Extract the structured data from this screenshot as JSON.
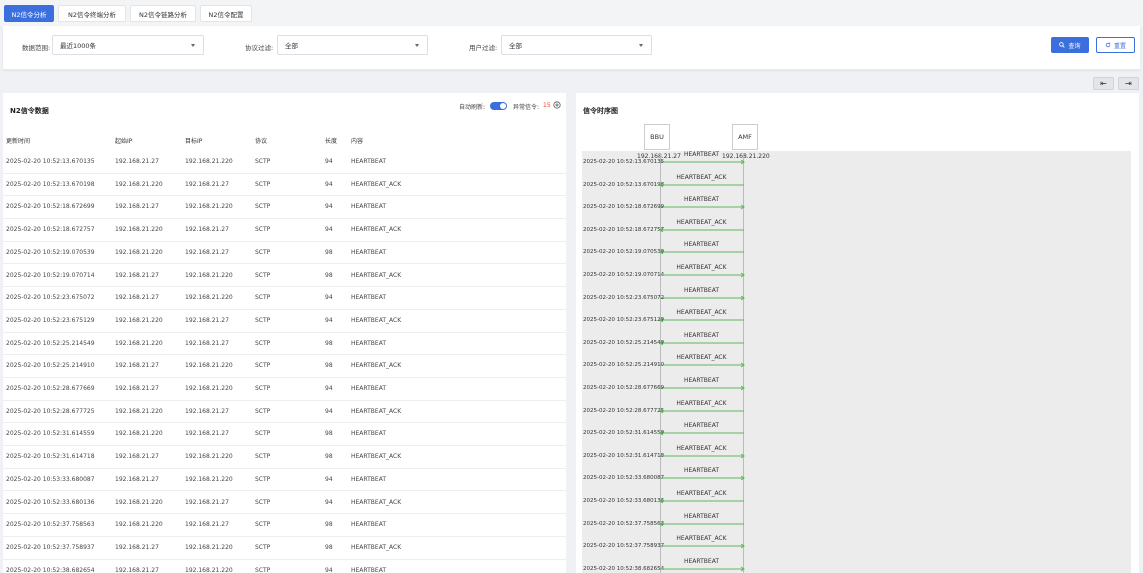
{
  "tabs": [
    {
      "label": "N2信令分析",
      "active": true
    },
    {
      "label": "N2信令终端分析",
      "active": false
    },
    {
      "label": "N2信令链路分析",
      "active": false
    },
    {
      "label": "N2信令配置",
      "active": false
    }
  ],
  "filters": {
    "data_range_label": "数据范围:",
    "data_range_value": "最近1000条",
    "protocol_label": "协议过滤:",
    "protocol_value": "全部",
    "user_label": "用户过滤:",
    "user_value": "全部",
    "query_label": "查询",
    "reset_label": "重置"
  },
  "table_panel": {
    "title": "N2信令数据",
    "auto_refresh_label": "自动刷新:",
    "auto_refresh_on": true,
    "abnormal_label": "异常信令:",
    "abnormal_count": "15",
    "columns": [
      "更新时间",
      "起始IP",
      "目标IP",
      "协议",
      "长度",
      "内容"
    ],
    "rows": [
      [
        "2025-02-20 10:52:13.670135",
        "192.168.21.27",
        "192.168.21.220",
        "SCTP",
        "94",
        "HEARTBEAT"
      ],
      [
        "2025-02-20 10:52:13.670198",
        "192.168.21.220",
        "192.168.21.27",
        "SCTP",
        "94",
        "HEARTBEAT_ACK"
      ],
      [
        "2025-02-20 10:52:18.672699",
        "192.168.21.27",
        "192.168.21.220",
        "SCTP",
        "94",
        "HEARTBEAT"
      ],
      [
        "2025-02-20 10:52:18.672757",
        "192.168.21.220",
        "192.168.21.27",
        "SCTP",
        "94",
        "HEARTBEAT_ACK"
      ],
      [
        "2025-02-20 10:52:19.070539",
        "192.168.21.220",
        "192.168.21.27",
        "SCTP",
        "98",
        "HEARTBEAT"
      ],
      [
        "2025-02-20 10:52:19.070714",
        "192.168.21.27",
        "192.168.21.220",
        "SCTP",
        "98",
        "HEARTBEAT_ACK"
      ],
      [
        "2025-02-20 10:52:23.675072",
        "192.168.21.27",
        "192.168.21.220",
        "SCTP",
        "94",
        "HEARTBEAT"
      ],
      [
        "2025-02-20 10:52:23.675129",
        "192.168.21.220",
        "192.168.21.27",
        "SCTP",
        "94",
        "HEARTBEAT_ACK"
      ],
      [
        "2025-02-20 10:52:25.214549",
        "192.168.21.220",
        "192.168.21.27",
        "SCTP",
        "98",
        "HEARTBEAT"
      ],
      [
        "2025-02-20 10:52:25.214910",
        "192.168.21.27",
        "192.168.21.220",
        "SCTP",
        "98",
        "HEARTBEAT_ACK"
      ],
      [
        "2025-02-20 10:52:28.677669",
        "192.168.21.27",
        "192.168.21.220",
        "SCTP",
        "94",
        "HEARTBEAT"
      ],
      [
        "2025-02-20 10:52:28.677725",
        "192.168.21.220",
        "192.168.21.27",
        "SCTP",
        "94",
        "HEARTBEAT_ACK"
      ],
      [
        "2025-02-20 10:52:31.614559",
        "192.168.21.220",
        "192.168.21.27",
        "SCTP",
        "98",
        "HEARTBEAT"
      ],
      [
        "2025-02-20 10:52:31.614718",
        "192.168.21.27",
        "192.168.21.220",
        "SCTP",
        "98",
        "HEARTBEAT_ACK"
      ],
      [
        "2025-02-20 10:53:33.680087",
        "192.168.21.27",
        "192.168.21.220",
        "SCTP",
        "94",
        "HEARTBEAT"
      ],
      [
        "2025-02-20 10:52:33.680136",
        "192.168.21.220",
        "192.168.21.27",
        "SCTP",
        "94",
        "HEARTBEAT_ACK"
      ],
      [
        "2025-02-20 10:52:37.758563",
        "192.168.21.220",
        "192.168.21.27",
        "SCTP",
        "98",
        "HEARTBEAT"
      ],
      [
        "2025-02-20 10:52:37.758937",
        "192.168.21.27",
        "192.168.21.220",
        "SCTP",
        "98",
        "HEARTBEAT_ACK"
      ],
      [
        "2025-02-20 10:52:38.682654",
        "192.168.21.27",
        "192.168.21.220",
        "SCTP",
        "94",
        "HEARTBEAT"
      ]
    ]
  },
  "sequence_panel": {
    "title": "信令时序图",
    "actors": [
      {
        "name": "BBU",
        "ip": "192.168.21.27"
      },
      {
        "name": "AMF",
        "ip": "192.168.21.220"
      }
    ],
    "messages": [
      {
        "time": "2025-02-20 10:52:13.670135",
        "label": "HEARTBEAT",
        "direction": "right"
      },
      {
        "time": "2025-02-20 10:52:13.670198",
        "label": "HEARTBEAT_ACK",
        "direction": "left"
      },
      {
        "time": "2025-02-20 10:52:18.672699",
        "label": "HEARTBEAT",
        "direction": "right"
      },
      {
        "time": "2025-02-20 10:52:18.672757",
        "label": "HEARTBEAT_ACK",
        "direction": "left"
      },
      {
        "time": "2025-02-20 10:52:19.070539",
        "label": "HEARTBEAT",
        "direction": "left"
      },
      {
        "time": "2025-02-20 10:52:19.070714",
        "label": "HEARTBEAT_ACK",
        "direction": "right"
      },
      {
        "time": "2025-02-20 10:52:23.675072",
        "label": "HEARTBEAT",
        "direction": "right"
      },
      {
        "time": "2025-02-20 10:52:23.675129",
        "label": "HEARTBEAT_ACK",
        "direction": "left"
      },
      {
        "time": "2025-02-20 10:52:25.214549",
        "label": "HEARTBEAT",
        "direction": "left"
      },
      {
        "time": "2025-02-20 10:52:25.214910",
        "label": "HEARTBEAT_ACK",
        "direction": "right"
      },
      {
        "time": "2025-02-20 10:52:28.677669",
        "label": "HEARTBEAT",
        "direction": "right"
      },
      {
        "time": "2025-02-20 10:52:28.677725",
        "label": "HEARTBEAT_ACK",
        "direction": "left"
      },
      {
        "time": "2025-02-20 10:52:31.614559",
        "label": "HEARTBEAT",
        "direction": "left"
      },
      {
        "time": "2025-02-20 10:52:31.614718",
        "label": "HEARTBEAT_ACK",
        "direction": "right"
      },
      {
        "time": "2025-02-20 10:52:33.680087",
        "label": "HEARTBEAT",
        "direction": "right"
      },
      {
        "time": "2025-02-20 10:52:33.680136",
        "label": "HEARTBEAT_ACK",
        "direction": "left"
      },
      {
        "time": "2025-02-20 10:52:37.758563",
        "label": "HEARTBEAT",
        "direction": "left"
      },
      {
        "time": "2025-02-20 10:52:37.758937",
        "label": "HEARTBEAT_ACK",
        "direction": "right"
      },
      {
        "time": "2025-02-20 10:52:38.682654",
        "label": "HEARTBEAT",
        "direction": "right"
      }
    ]
  },
  "colors": {
    "accent": "#3b6fde",
    "abnormal": "#e8462f",
    "arrow": "#5cb85c"
  },
  "icons": {
    "query": "search-icon",
    "reset": "refresh-icon",
    "abnormal_info": "plus-circle-icon",
    "collapse_left": "collapse-left-icon",
    "collapse_right": "collapse-right-icon"
  }
}
